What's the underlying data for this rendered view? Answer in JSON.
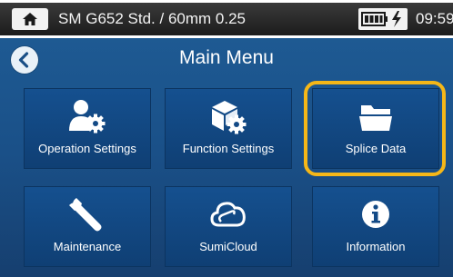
{
  "status_bar": {
    "title": "SM G652 Std. / 60mm 0.25",
    "clock": "09:59",
    "home_icon": "home-icon",
    "battery_icon": "battery-charging-icon",
    "bar_color": "#2a2a2a"
  },
  "header": {
    "title": "Main Menu",
    "back_icon": "back-arrow-icon"
  },
  "menu": {
    "tiles": [
      {
        "label": "Operation Settings",
        "icon": "user-gear-icon"
      },
      {
        "label": "Function Settings",
        "icon": "box-gear-icon"
      },
      {
        "label": "Splice Data",
        "icon": "folder-open-icon",
        "highlighted": true
      },
      {
        "label": "Maintenance",
        "icon": "wrench-icon"
      },
      {
        "label": "SumiCloud",
        "icon": "cloud-icon"
      },
      {
        "label": "Information",
        "icon": "info-icon"
      }
    ]
  },
  "colors": {
    "background": "#1a5088",
    "tile": "#134a86",
    "highlight": "#f5b718",
    "text": "#ffffff"
  }
}
